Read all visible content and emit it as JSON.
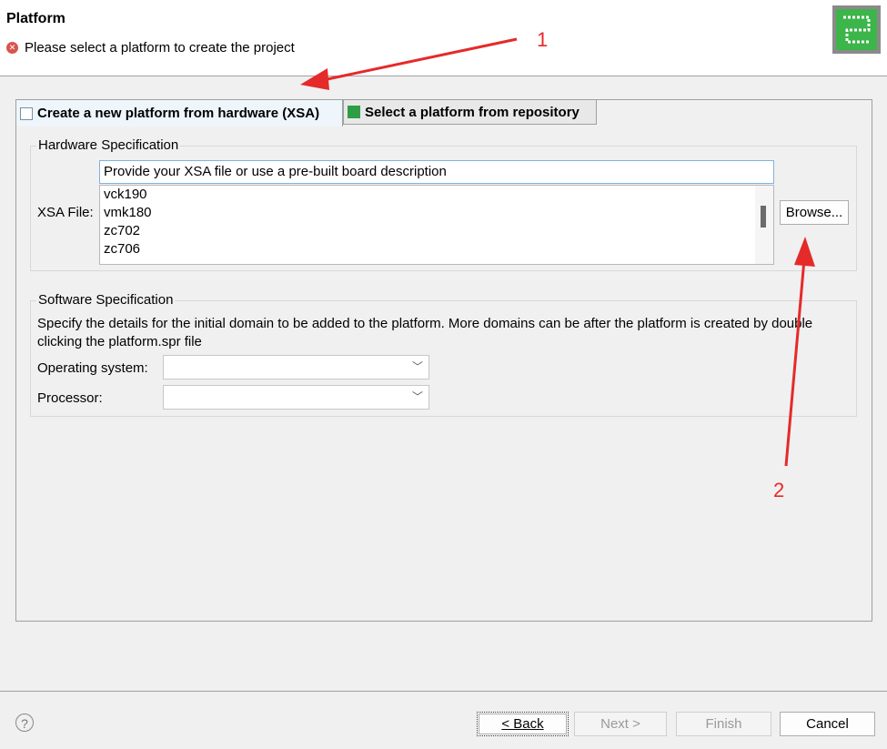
{
  "header": {
    "title": "Platform",
    "message": "Please select a platform to create the project"
  },
  "tabs": [
    {
      "label": "Create a new platform from hardware (XSA)",
      "active": true
    },
    {
      "label": "Select a platform from repository",
      "active": false
    }
  ],
  "hardware": {
    "group_label": "Hardware Specification",
    "xsa_label": "XSA File:",
    "xsa_input_value": "Provide your XSA file or use a pre-built board description",
    "xsa_options": [
      "vck190",
      "vmk180",
      "zc702",
      "zc706"
    ],
    "browse_label": "Browse..."
  },
  "software": {
    "group_label": "Software Specification",
    "description": "Specify the details for the initial domain to be added to the platform. More domains can be after the platform is created by double clicking the platform.spr file",
    "os_label": "Operating system:",
    "os_value": "",
    "processor_label": "Processor:",
    "processor_value": ""
  },
  "annotations": {
    "one": "1",
    "two": "2"
  },
  "footer": {
    "help": "?",
    "back": "< Back",
    "next": "Next >",
    "finish": "Finish",
    "cancel": "Cancel"
  },
  "colors": {
    "accent": "#3cb54a",
    "annotation": "#e52a2a",
    "error": "#d9534f"
  }
}
